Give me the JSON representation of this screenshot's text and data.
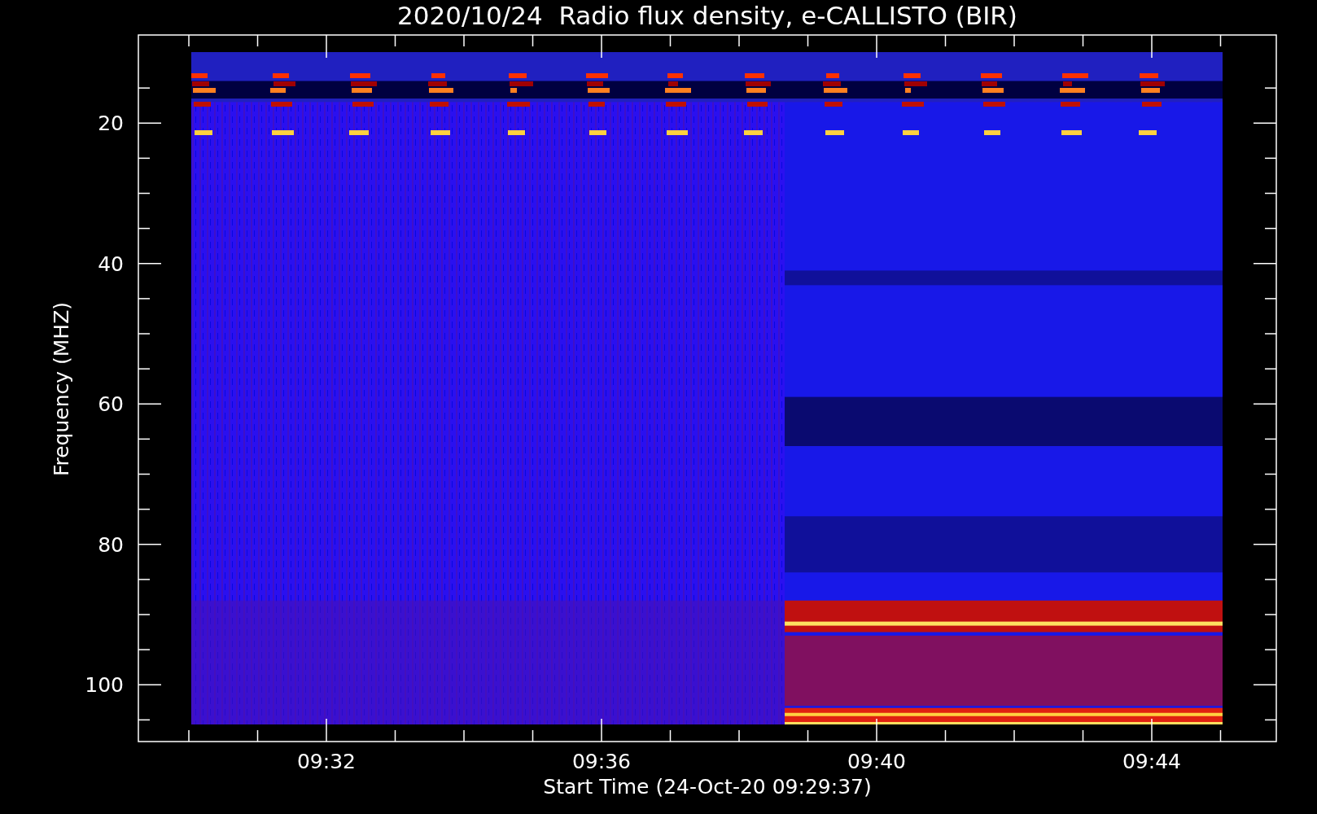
{
  "title": "2020/10/24  Radio flux density, e-CALLISTO (BIR)",
  "xlabel": "Start Time (24-Oct-20 09:29:37)",
  "ylabel": "Frequency (MHZ)",
  "xticks": [
    "09:32",
    "09:36",
    "09:40",
    "09:44"
  ],
  "yticks": [
    "20",
    "40",
    "60",
    "80",
    "100"
  ]
}
